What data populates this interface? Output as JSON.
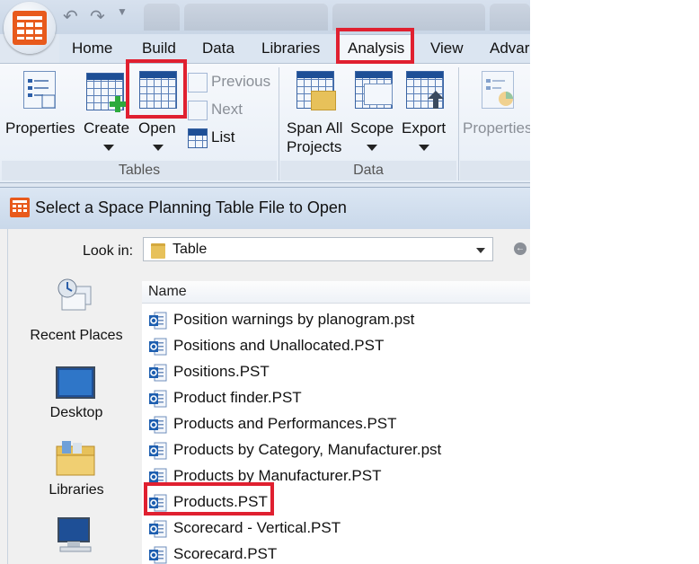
{
  "tabs": [
    "Home",
    "Build",
    "Data",
    "Libraries",
    "Analysis",
    "View",
    "Advar"
  ],
  "active_tab": "Analysis",
  "ribbon": {
    "tables_group": {
      "label": "Tables",
      "properties": "Properties",
      "create": "Create",
      "open": "Open",
      "previous": "Previous",
      "next": "Next",
      "list": "List"
    },
    "data_group": {
      "label": "Data",
      "span_all_projects_line1": "Span All",
      "span_all_projects_line2": "Projects",
      "scope": "Scope",
      "export": "Export"
    },
    "third_group": {
      "properties": "Properties"
    }
  },
  "dialog": {
    "title": "Select a Space Planning Table File to Open",
    "look_in_label": "Look in:",
    "look_in_value": "Table",
    "places": [
      "Recent Places",
      "Desktop",
      "Libraries"
    ],
    "column_header": "Name",
    "files": [
      "Position warnings by planogram.pst",
      "Positions and Unallocated.PST",
      "Positions.PST",
      "Product finder.PST",
      "Products and Performances.PST",
      "Products by Category, Manufacturer.pst",
      "Products by Manufacturer.PST",
      "Products.PST",
      "Scorecard - Vertical.PST",
      "Scorecard.PST"
    ],
    "highlighted_file": "Products.PST"
  },
  "colors": {
    "highlight_box": "#e02030",
    "app_accent": "#e85a1c",
    "icon_blue": "#1e4f96"
  }
}
